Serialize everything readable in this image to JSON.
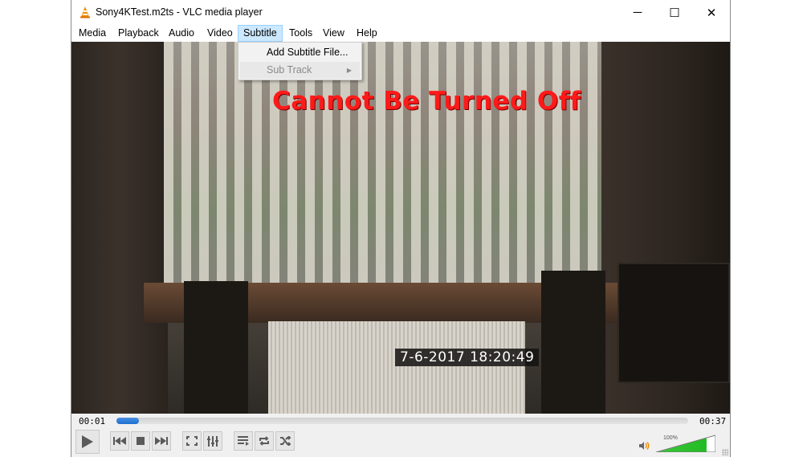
{
  "window": {
    "title": "Sony4KTest.m2ts - VLC media player",
    "controls": {
      "minimize": "─",
      "maximize": "☐",
      "close": "✕"
    }
  },
  "menubar": {
    "items": [
      {
        "label": "Media"
      },
      {
        "label": "Playback"
      },
      {
        "label": "Audio"
      },
      {
        "label": "Video"
      },
      {
        "label": "Subtitle",
        "active": true
      },
      {
        "label": "Tools"
      },
      {
        "label": "View"
      },
      {
        "label": "Help"
      }
    ]
  },
  "subtitle_menu": {
    "items": [
      {
        "label": "Add Subtitle File...",
        "enabled": true
      },
      {
        "label": "Sub Track",
        "enabled": false,
        "submenu_arrow": "▶"
      }
    ]
  },
  "video": {
    "subtitle_text": "Cannot Be Turned Off",
    "subtitle_color": "#ff1a1a",
    "timestamp_overlay": "7-6-2017  18:20:49"
  },
  "player": {
    "elapsed": "00:01",
    "total": "00:37",
    "progress_fraction": 0.04,
    "volume_label": "100%",
    "volume_fraction": 1.0,
    "accent_color": "#1a6fd0",
    "volume_color": "#22bb22",
    "buttons": [
      {
        "name": "play",
        "icon": "play-icon"
      },
      {
        "name": "previous",
        "icon": "skip-back-icon"
      },
      {
        "name": "stop",
        "icon": "stop-icon"
      },
      {
        "name": "next",
        "icon": "skip-forward-icon"
      },
      {
        "name": "fullscreen",
        "icon": "fullscreen-icon"
      },
      {
        "name": "extended-settings",
        "icon": "equalizer-icon"
      },
      {
        "name": "playlist",
        "icon": "playlist-icon"
      },
      {
        "name": "loop",
        "icon": "loop-icon"
      },
      {
        "name": "random",
        "icon": "shuffle-icon"
      }
    ]
  }
}
